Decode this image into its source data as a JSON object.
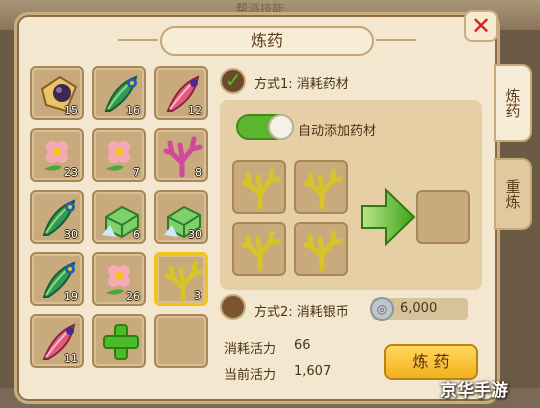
{
  "background": {
    "title": "帮派技能"
  },
  "dialog": {
    "title": "炼药"
  },
  "tabs": [
    {
      "label": "炼药",
      "active": true
    },
    {
      "label": "重炼",
      "active": false
    }
  ],
  "grid": [
    {
      "icon": "ink-pouch",
      "count": "15"
    },
    {
      "icon": "peacock-feather",
      "count": "16"
    },
    {
      "icon": "red-feather",
      "count": "12"
    },
    {
      "icon": "flower",
      "count": "23"
    },
    {
      "icon": "flower",
      "count": "7"
    },
    {
      "icon": "coral",
      "count": "8"
    },
    {
      "icon": "peacock-feather",
      "count": "30"
    },
    {
      "icon": "jade-cube",
      "count": "6"
    },
    {
      "icon": "jade-cube",
      "count": "30"
    },
    {
      "icon": "peacock-feather",
      "count": "19"
    },
    {
      "icon": "flower",
      "count": "26"
    },
    {
      "icon": "yellow-coral",
      "count": "3",
      "selected": true
    },
    {
      "icon": "red-feather",
      "count": "11"
    },
    {
      "icon": "plus",
      "count": ""
    },
    {
      "icon": "empty",
      "count": ""
    }
  ],
  "method1": {
    "label": "方式1: 消耗药材",
    "checked": true
  },
  "auto_add": {
    "label": "自动添加药材",
    "on": true
  },
  "ingredients": [
    "yellow-coral",
    "yellow-coral",
    "yellow-coral",
    "yellow-coral"
  ],
  "method2": {
    "label": "方式2: 消耗银币",
    "silver": "6,000"
  },
  "stats": [
    {
      "label": "消耗活力",
      "value": "66"
    },
    {
      "label": "当前活力",
      "value": "1,607"
    }
  ],
  "refine_button": "炼 药",
  "watermark": "京华手游",
  "colors": {
    "accent_green": "#5cb52e",
    "button_gold": "#f2b11e",
    "close_red": "#d3221c"
  }
}
